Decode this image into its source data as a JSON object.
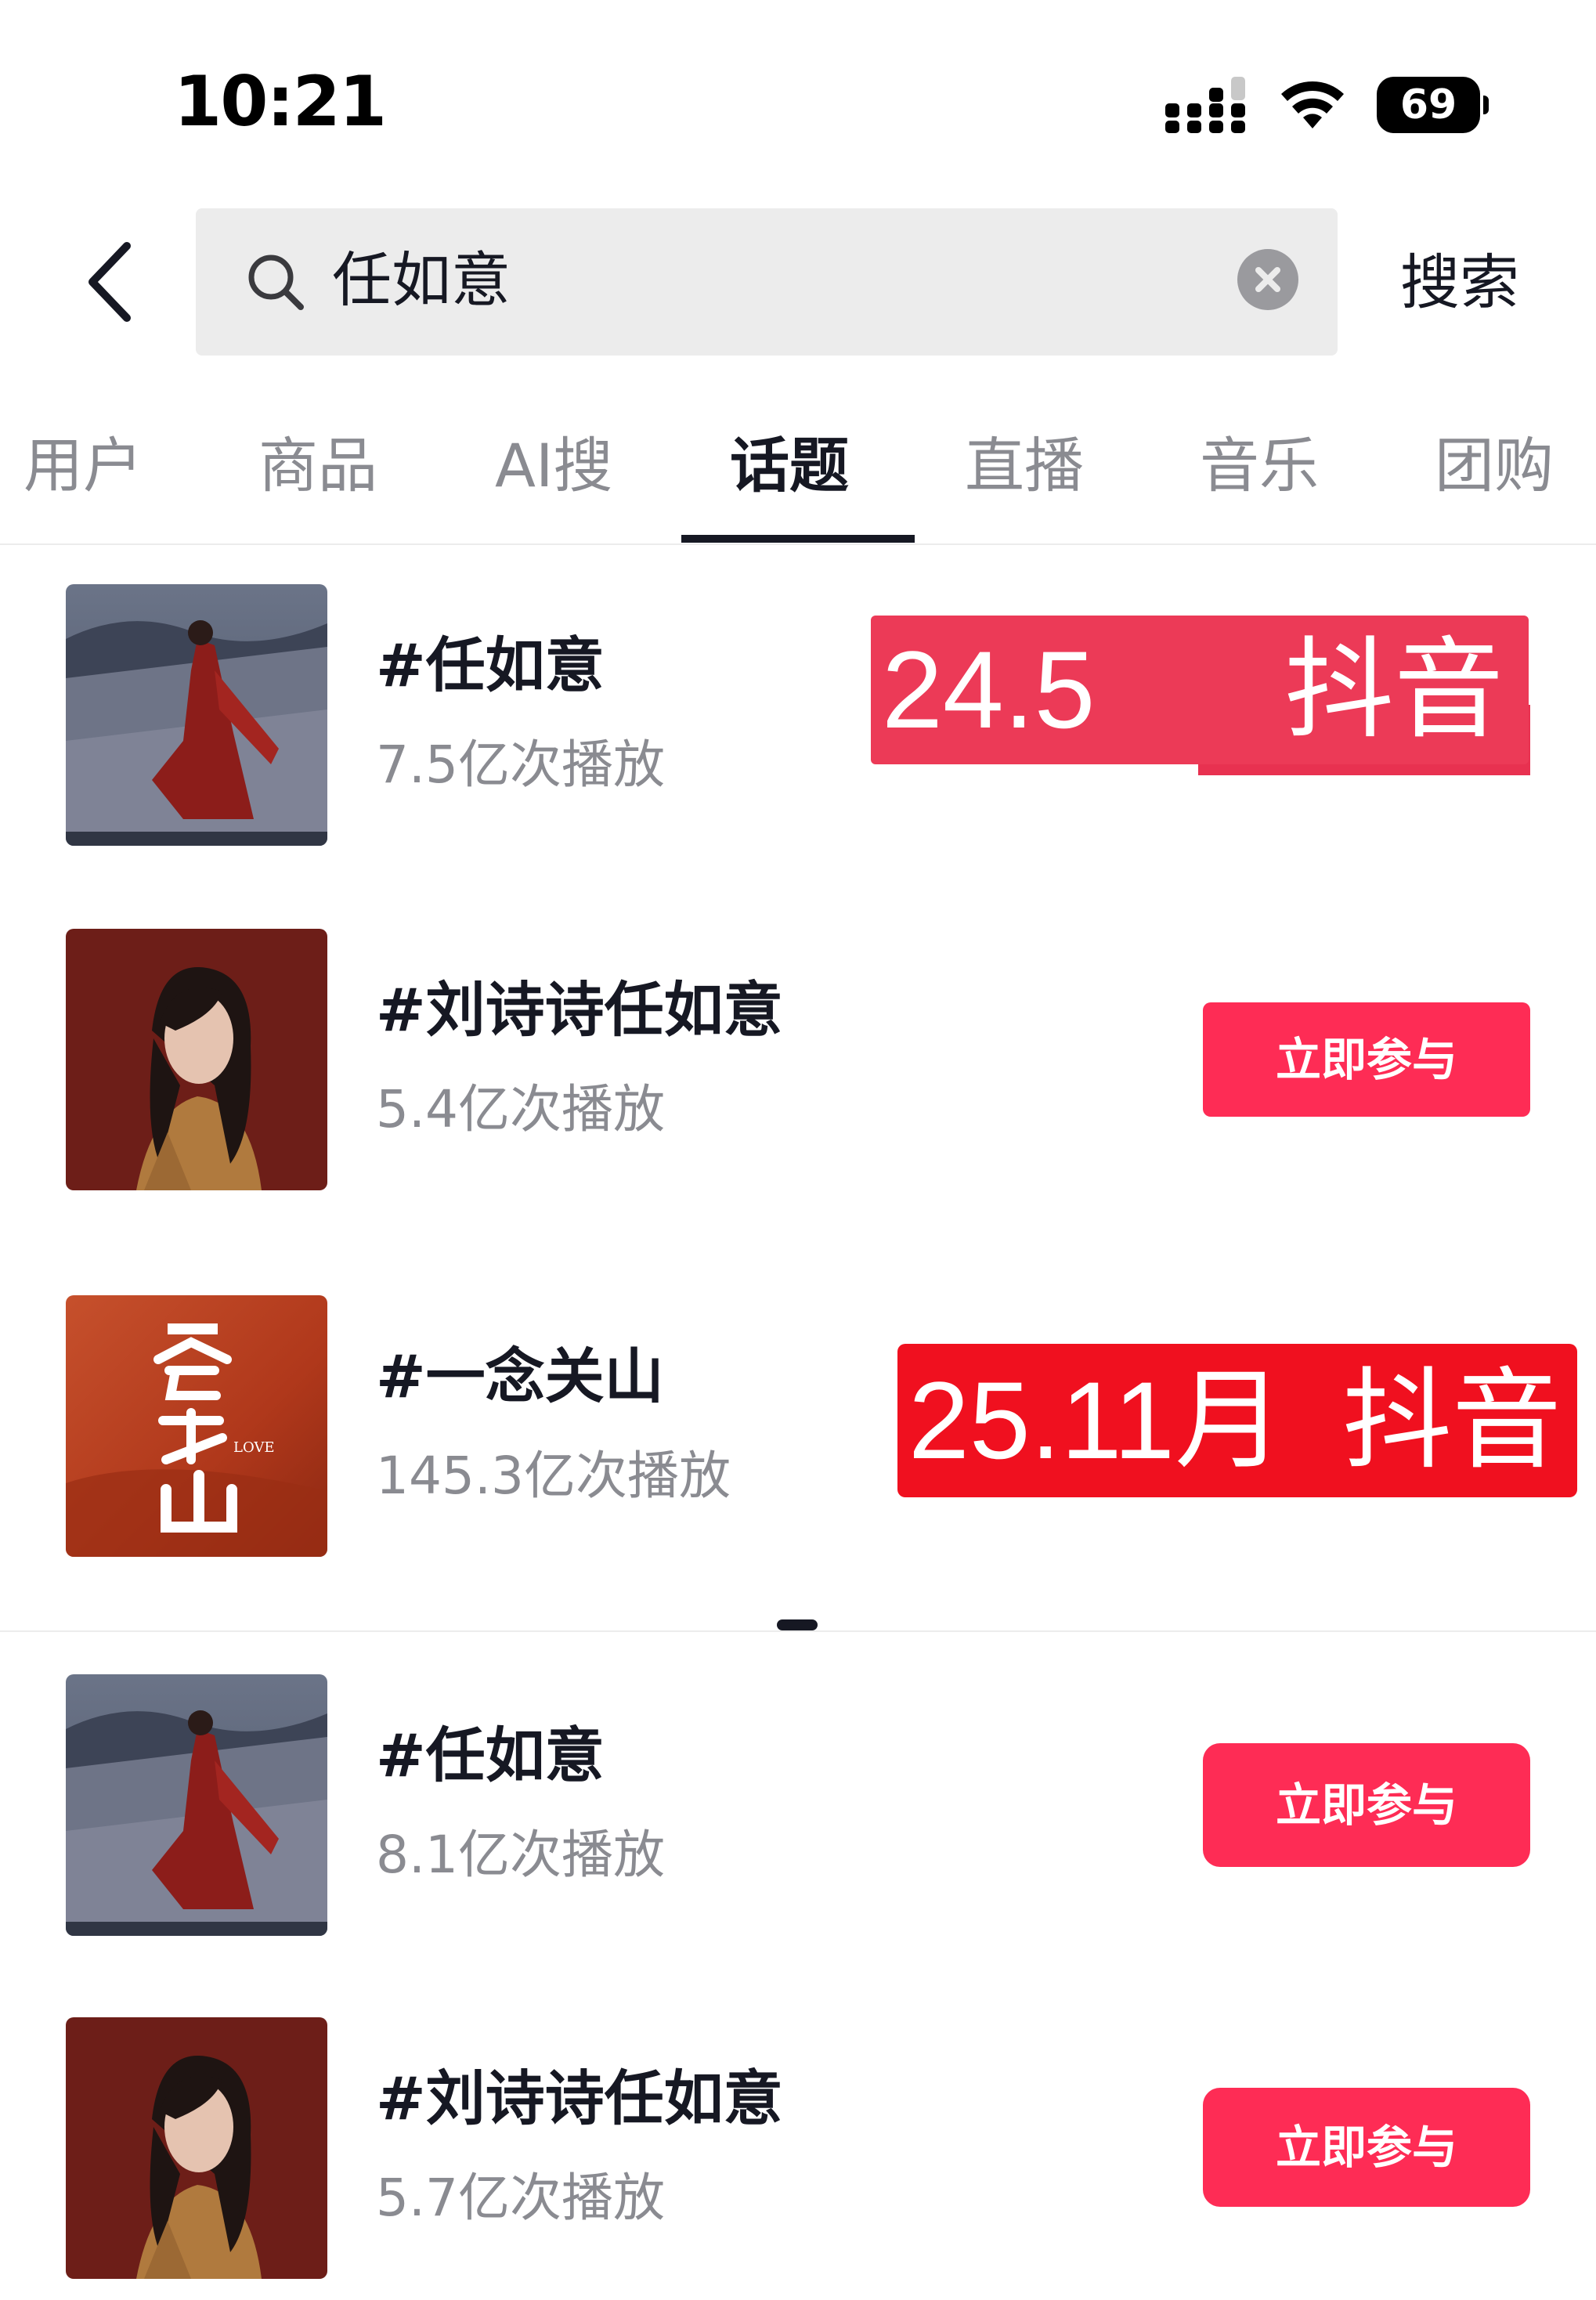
{
  "status_bar": {
    "time": "10:21",
    "battery_level": "69",
    "icons": [
      "cellular-signal-icon",
      "wifi-icon",
      "battery-icon"
    ]
  },
  "search": {
    "back_icon": "chevron-left-icon",
    "search_icon": "magnifier-icon",
    "query": "任如意",
    "clear_icon": "clear-circle-icon",
    "submit_label": "搜索"
  },
  "tabs": [
    {
      "label": "用户",
      "active": false
    },
    {
      "label": "商品",
      "active": false
    },
    {
      "label": "AI搜",
      "active": false
    },
    {
      "label": "话题",
      "active": true
    },
    {
      "label": "直播",
      "active": false
    },
    {
      "label": "音乐",
      "active": false
    },
    {
      "label": "团购",
      "active": false
    }
  ],
  "topics": [
    {
      "name": "#任如意",
      "plays": "7.5亿次播放",
      "thumbnail": "desert-red-dress-photo"
    },
    {
      "name": "#刘诗诗任如意",
      "plays": "5.4亿次播放",
      "thumbnail": "portrait-brown-sweater-photo",
      "action": "立即参与"
    },
    {
      "name": "#一念关山",
      "plays": "145.3亿次播放",
      "thumbnail": "poster-calligraphy-red"
    },
    {
      "name": "#任如意",
      "plays": "8.1亿次播放",
      "thumbnail": "desert-red-dress-photo",
      "action": "立即参与"
    },
    {
      "name": "#刘诗诗任如意",
      "plays": "5.7亿次播放",
      "thumbnail": "portrait-brown-sweater-photo",
      "action": "立即参与"
    }
  ],
  "overlays": [
    {
      "left_text": "24.5",
      "right_text": "抖音",
      "color": "#ec3a57"
    },
    {
      "left_text": "25.11月",
      "right_text": "抖音",
      "color": "#f0101f"
    }
  ],
  "colors": {
    "accent": "#fe2c55",
    "text_primary": "#161823",
    "text_secondary": "#8a8b91",
    "search_bg": "#ececec"
  }
}
